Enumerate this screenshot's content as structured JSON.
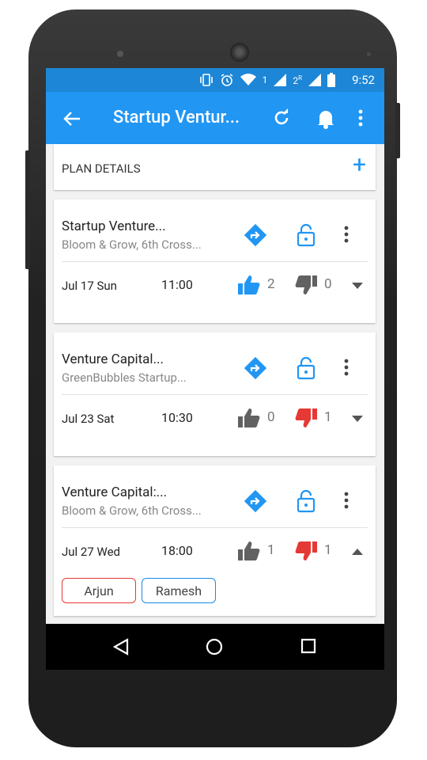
{
  "status_bar": {
    "time": "9:52",
    "sim1": "1",
    "sim2": "2",
    "sim2_sup": "R"
  },
  "app_bar": {
    "title": "Startup Ventur..."
  },
  "plan_header": {
    "label": "PLAN DETAILS",
    "add_symbol": "+"
  },
  "events": [
    {
      "name": "Startup Venture...",
      "location": "Bloom & Grow, 6th Cross...",
      "date": "Jul 17 Sun",
      "time": "11:00",
      "likes": "2",
      "dislikes": "0",
      "liked": true,
      "disliked": false,
      "expanded": false
    },
    {
      "name": "Venture Capital...",
      "location": "GreenBubbles Startup...",
      "date": "Jul 23 Sat",
      "time": "10:30",
      "likes": "0",
      "dislikes": "1",
      "liked": false,
      "disliked": true,
      "expanded": false
    },
    {
      "name": "Venture Capital:...",
      "location": "Bloom & Grow, 6th Cross...",
      "date": "Jul 27 Wed",
      "time": "18:00",
      "likes": "1",
      "dislikes": "1",
      "liked": false,
      "disliked": true,
      "expanded": true,
      "attendees": [
        {
          "name": "Arjun",
          "color": "#e53935"
        },
        {
          "name": "Ramesh",
          "color": "#1e88e5"
        }
      ]
    }
  ],
  "colors": {
    "primary": "#2196f3",
    "status_bar": "#1d86d6",
    "like_active": "#2196f3",
    "dislike_active": "#e53935",
    "inactive": "#616161"
  }
}
